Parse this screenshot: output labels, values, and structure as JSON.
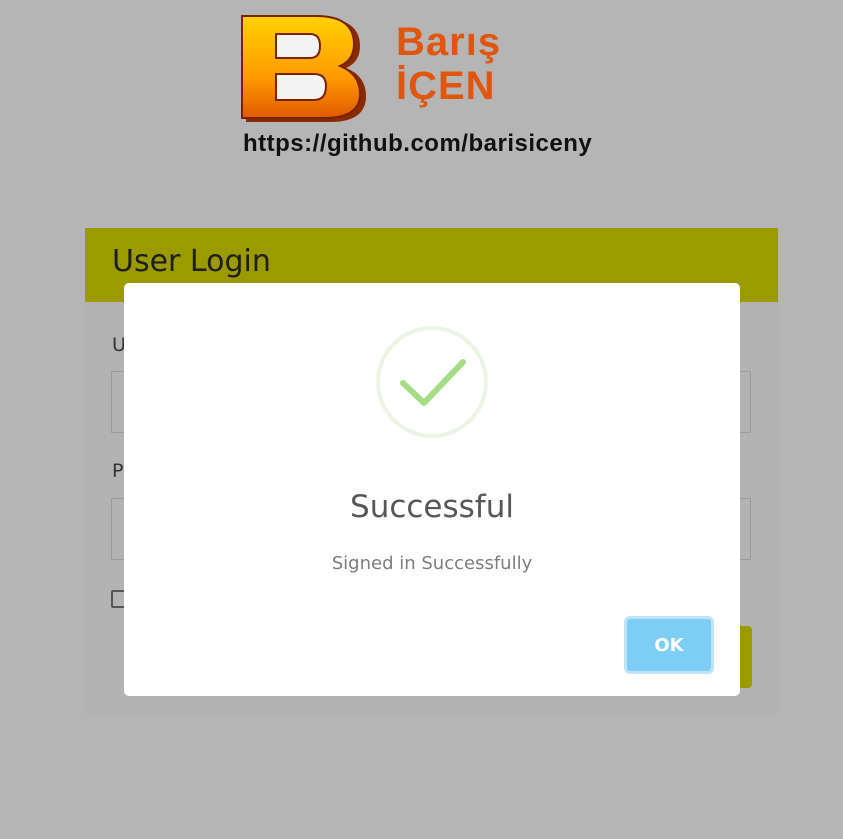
{
  "branding": {
    "logo_letter": "B",
    "name_line1": "Barış",
    "name_line2": "İÇEN",
    "url": "https://github.com/barisiceny",
    "logo_icon": "b-logo-icon",
    "brand_color": "#e0560f"
  },
  "login": {
    "title": "User Login",
    "username_label": "U",
    "password_label": "P",
    "header_color": "#9b9b00"
  },
  "modal": {
    "icon": "checkmark-icon",
    "title": "Successful",
    "message": "Signed in Successfully",
    "ok_label": "OK",
    "accent_color": "#7dcdf4",
    "check_color": "#a5dc86"
  }
}
